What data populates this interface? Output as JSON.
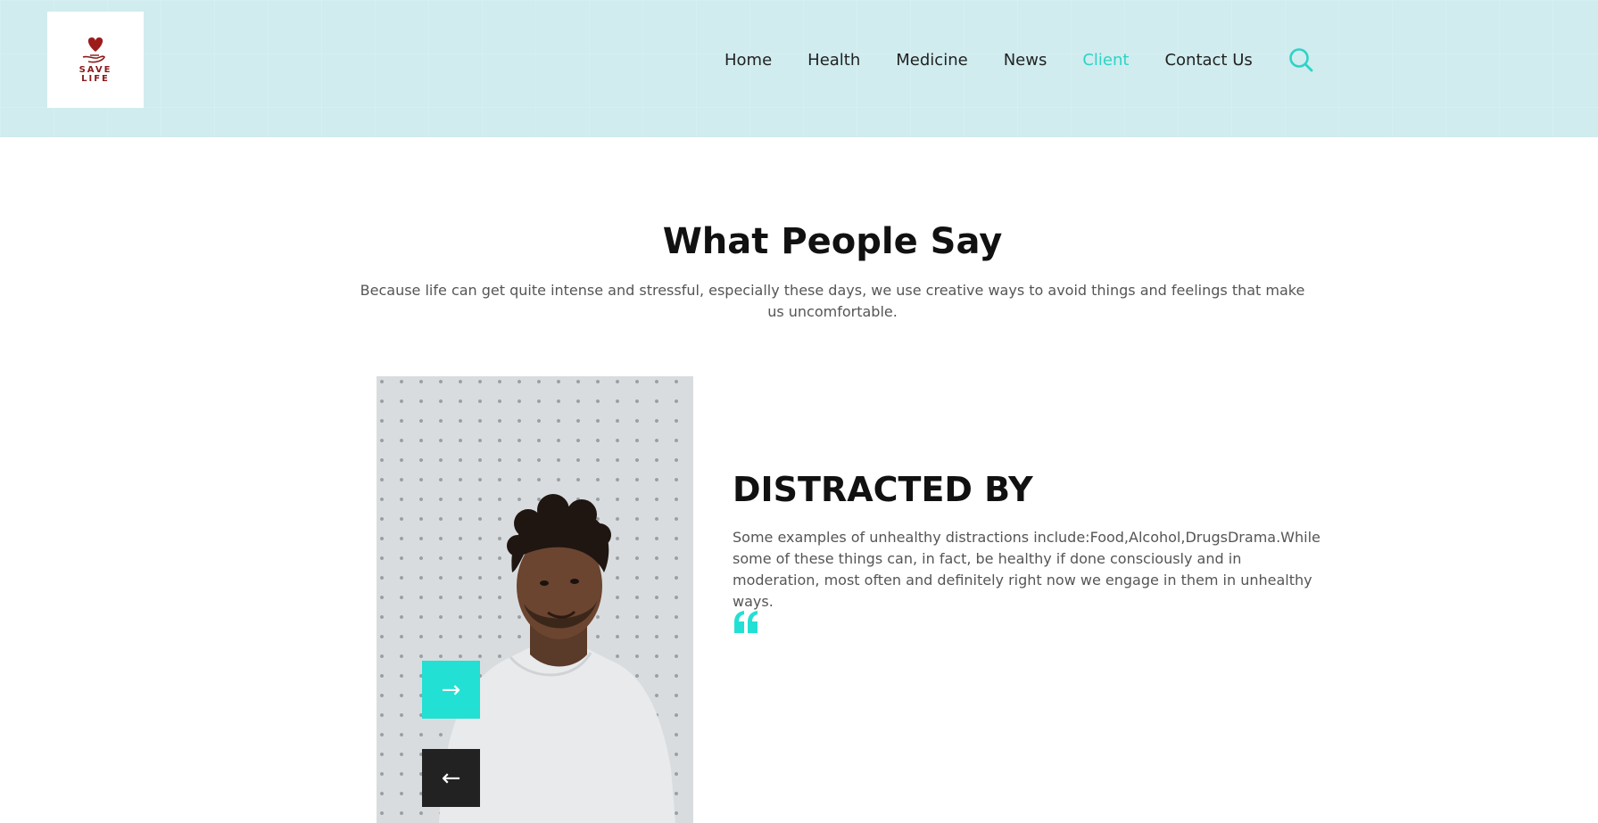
{
  "header": {
    "logo": {
      "line1": "SAVE",
      "line2": "LIFE",
      "heart_color": "#8b1a1a"
    },
    "nav": [
      {
        "label": "Home",
        "active": false
      },
      {
        "label": "Health",
        "active": false
      },
      {
        "label": "Medicine",
        "active": false
      },
      {
        "label": "News",
        "active": false
      },
      {
        "label": "Client",
        "active": true
      },
      {
        "label": "Contact Us",
        "active": false
      }
    ],
    "search_icon": "search-icon",
    "background_color": "#d0ecef",
    "accent_color": "#2ed3c6"
  },
  "section": {
    "title": "What People Say",
    "subtitle": "Because life can get quite intense and stressful, especially these days, we use creative ways to avoid things and feelings that make us uncomfortable."
  },
  "testimonial": {
    "title": "DISTRACTED BY",
    "text": "Some examples of unhealthy distractions include:Food,Alcohol,DrugsDrama.While some of these things can, in fact, be healthy if done consciously and in moderation, most often and definitely right now we engage in them in unhealthy ways.",
    "quote_icon": "quote-icon",
    "next_arrow": "→",
    "prev_arrow": "←",
    "next_color": "#22e0d3",
    "prev_color": "#222222"
  }
}
